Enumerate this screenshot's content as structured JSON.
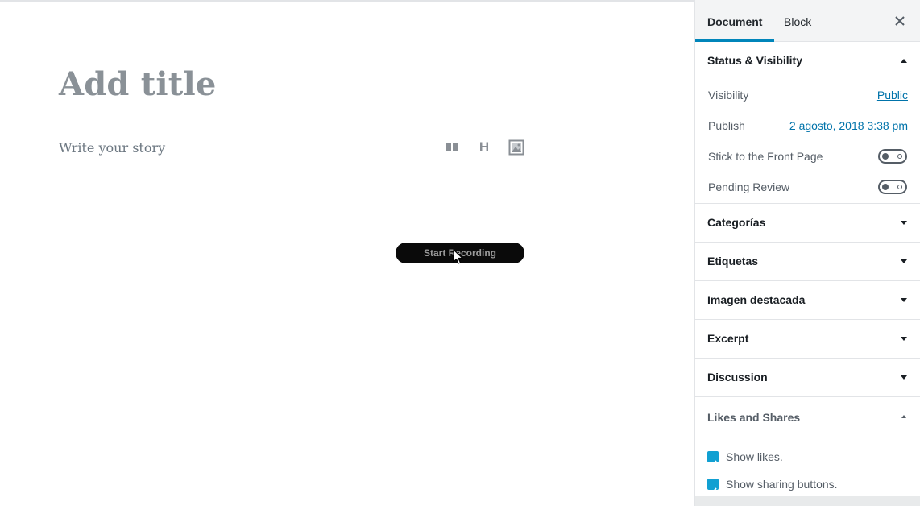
{
  "editor": {
    "title_placeholder": "Add title",
    "body_placeholder": "Write your story",
    "inserter": {
      "icons": [
        "gallery-icon",
        "heading-icon",
        "image-icon"
      ],
      "heading_glyph": "H"
    },
    "recording_label": "Start Recording"
  },
  "sidebar": {
    "tabs": [
      {
        "label": "Document",
        "active": true
      },
      {
        "label": "Block",
        "active": false
      }
    ],
    "close_glyph": "✕",
    "status_panel": {
      "title": "Status & Visibility",
      "expanded": true,
      "rows": [
        {
          "label": "Visibility",
          "value": "Public"
        },
        {
          "label": "Publish",
          "value": "2 agosto, 2018 3:38 pm"
        }
      ],
      "toggles": [
        {
          "label": "Stick to the Front Page",
          "on": false
        },
        {
          "label": "Pending Review",
          "on": false
        }
      ]
    },
    "collapsed_panels": [
      {
        "title": "Categorías"
      },
      {
        "title": "Etiquetas"
      },
      {
        "title": "Imagen destacada"
      },
      {
        "title": "Excerpt"
      },
      {
        "title": "Discussion"
      }
    ],
    "likes_panel": {
      "title": "Likes and Shares",
      "expanded": true,
      "options": [
        {
          "label": "Show likes.",
          "checked": true
        },
        {
          "label": "Show sharing buttons.",
          "checked": true
        }
      ]
    }
  },
  "colors": {
    "accent": "#0085ba",
    "link": "#0073aa",
    "checkbox": "#11a0d2",
    "placeholder": "#8a9197"
  }
}
